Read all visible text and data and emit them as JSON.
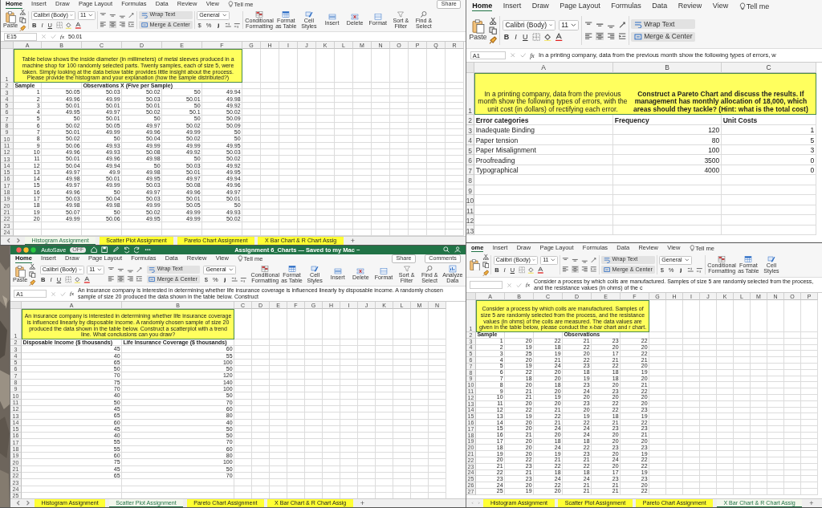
{
  "windows": [
    {
      "tabs": [
        {
          "label": "Home",
          "selected": true
        },
        {
          "label": "Insert",
          "selected": false
        },
        {
          "label": "Draw",
          "selected": false
        },
        {
          "label": "Page Layout",
          "selected": false
        },
        {
          "label": "Formulas",
          "selected": false
        },
        {
          "label": "Data",
          "selected": false
        },
        {
          "label": "Review",
          "selected": false
        },
        {
          "label": "View",
          "selected": false
        }
      ],
      "tell_me": "Tell me",
      "tab_buttons": [
        "Share"
      ],
      "toolbar": {
        "paste": "Paste",
        "font": "Calibri (Body)",
        "size": "11",
        "styles": [
          "B",
          "I",
          "U"
        ],
        "wrap": "Wrap Text",
        "merge": "Merge & Center",
        "number_format": "General",
        "currency": "$",
        "percent": "%",
        "commands": [
          "Conditional Formatting",
          "Format as Table",
          "Cell Styles",
          "Insert",
          "Delete",
          "Format",
          "Sort & Filter",
          "Find & Select"
        ]
      },
      "name_box": "E15",
      "function_label": "fx",
      "formula": "50.01",
      "columns": [
        "A",
        "B",
        "C",
        "D",
        "E",
        "F",
        "G",
        "H",
        "I",
        "J",
        "K",
        "L",
        "M",
        "N",
        "O",
        "P",
        "Q",
        "R"
      ],
      "rows": [
        {
          "number": "1",
          "kind": "note",
          "text": "Table below shows the inside diameter (in millimeters) of metal sleeves produced in a machine shop for 100 randomly selected parts. Twenty samples, each of size 5, were taken. Simply looking at the data below table provides little insight about the process. Please provide the histogram and your explanation (how the sample distributed?)"
        },
        {
          "number": "2",
          "kind": "header",
          "cells": [
            "Sample",
            "Observations X (Five per Sample)"
          ]
        },
        {
          "number": "3",
          "kind": "data",
          "cells": [
            "1",
            "50.05",
            "50.03",
            "50.02",
            "50",
            "49.94"
          ]
        },
        {
          "number": "4",
          "kind": "data",
          "cells": [
            "2",
            "49.96",
            "49.99",
            "50.03",
            "50.01",
            "49.98"
          ]
        },
        {
          "number": "5",
          "kind": "data",
          "cells": [
            "3",
            "50.01",
            "50.01",
            "50.01",
            "50",
            "49.92"
          ]
        },
        {
          "number": "6",
          "kind": "data",
          "cells": [
            "4",
            "49.95",
            "49.97",
            "50.02",
            "50.1",
            "50.02"
          ]
        },
        {
          "number": "7",
          "kind": "data",
          "cells": [
            "5",
            "50",
            "50.01",
            "50",
            "50",
            "50.09"
          ]
        },
        {
          "number": "8",
          "kind": "data",
          "cells": [
            "6",
            "50.02",
            "50.05",
            "49.97",
            "50.02",
            "50.09"
          ]
        },
        {
          "number": "9",
          "kind": "data",
          "cells": [
            "7",
            "50.01",
            "49.99",
            "49.96",
            "49.99",
            "50"
          ]
        },
        {
          "number": "10",
          "kind": "data",
          "cells": [
            "8",
            "50.02",
            "50",
            "50.04",
            "50.02",
            "50"
          ]
        },
        {
          "number": "11",
          "kind": "data",
          "cells": [
            "9",
            "50.06",
            "49.93",
            "49.99",
            "49.99",
            "49.95"
          ]
        },
        {
          "number": "12",
          "kind": "data",
          "cells": [
            "10",
            "49.96",
            "49.93",
            "50.08",
            "49.92",
            "50.03"
          ]
        },
        {
          "number": "13",
          "kind": "data",
          "cells": [
            "11",
            "50.01",
            "49.96",
            "49.98",
            "50",
            "50.02"
          ]
        },
        {
          "number": "14",
          "kind": "data",
          "cells": [
            "12",
            "50.04",
            "49.94",
            "50",
            "50.03",
            "49.92"
          ]
        },
        {
          "number": "15",
          "kind": "data",
          "cells": [
            "13",
            "49.97",
            "49.9",
            "49.98",
            "50.01",
            "49.95"
          ]
        },
        {
          "number": "16",
          "kind": "data",
          "cells": [
            "14",
            "49.98",
            "50.01",
            "49.95",
            "49.97",
            "49.94"
          ]
        },
        {
          "number": "17",
          "kind": "data",
          "cells": [
            "15",
            "49.97",
            "49.99",
            "50.03",
            "50.08",
            "49.96"
          ]
        },
        {
          "number": "18",
          "kind": "data",
          "cells": [
            "16",
            "49.96",
            "50",
            "49.97",
            "49.96",
            "49.97"
          ]
        },
        {
          "number": "19",
          "kind": "data",
          "cells": [
            "17",
            "50.03",
            "50.04",
            "50.03",
            "50.01",
            "50.01"
          ]
        },
        {
          "number": "20",
          "kind": "data",
          "cells": [
            "18",
            "49.98",
            "49.98",
            "49.99",
            "50.05",
            "50"
          ]
        },
        {
          "number": "21",
          "kind": "data",
          "cells": [
            "19",
            "50.07",
            "50",
            "50.02",
            "49.99",
            "49.93"
          ]
        },
        {
          "number": "22",
          "kind": "data",
          "cells": [
            "20",
            "49.99",
            "50.06",
            "49.95",
            "49.99",
            "50.02"
          ]
        },
        {
          "number": "23",
          "kind": "empty"
        },
        {
          "number": "24",
          "kind": "empty"
        }
      ],
      "sheet_tabs": [
        {
          "label": "Histogram Assignment",
          "selected": true
        },
        {
          "label": "Scatter Plot Assignment",
          "selected": false
        },
        {
          "label": "Pareto Chart Assignment",
          "selected": false
        },
        {
          "label": "X Bar Chart & R Chart Assig",
          "selected": false
        }
      ],
      "add_sheet": "+"
    },
    {
      "tabs": [
        {
          "label": "Home",
          "selected": true
        },
        {
          "label": "Insert",
          "selected": false
        },
        {
          "label": "Draw",
          "selected": false
        },
        {
          "label": "Page Layout",
          "selected": false
        },
        {
          "label": "Formulas",
          "selected": false
        },
        {
          "label": "Data",
          "selected": false
        },
        {
          "label": "Review",
          "selected": false
        },
        {
          "label": "View",
          "selected": false
        }
      ],
      "tell_me": "Tell me",
      "toolbar": {
        "paste": "Paste",
        "font": "Calibri (Body)",
        "size": "11",
        "styles": [
          "B",
          "I",
          "U"
        ],
        "wrap": "Wrap Text",
        "merge": "Merge & Center"
      },
      "name_box": "A1",
      "function_label": "fx",
      "formula": "In a printing company, data from the previous month show the following types of errors, w",
      "columns": [
        "A",
        "B",
        "C"
      ],
      "rows": [
        {
          "number": "1",
          "kind": "note",
          "text": "In a printing company, data from the previous month show the following types of errors, with the unit cost (in dollars) of rectifying each error. **Construct a Pareto Chart and discuss the results. If management has monthly allocation of 18,000, which areas should they tackle? (Hint: what is the total cost)**"
        },
        {
          "number": "2",
          "kind": "header",
          "cells": [
            "Error categories",
            "Frequency",
            "Unit Costs"
          ]
        },
        {
          "number": "3",
          "kind": "data",
          "cells": [
            "Inadequate Binding",
            "120",
            "1"
          ]
        },
        {
          "number": "4",
          "kind": "data",
          "cells": [
            "Paper tension",
            "80",
            "5"
          ]
        },
        {
          "number": "5",
          "kind": "data",
          "cells": [
            "Paper Misalignment",
            "100",
            "3"
          ]
        },
        {
          "number": "6",
          "kind": "data",
          "cells": [
            "Proofreading",
            "3500",
            "0"
          ]
        },
        {
          "number": "7",
          "kind": "data",
          "cells": [
            "Typographical",
            "4000",
            "0"
          ]
        },
        {
          "number": "8",
          "kind": "empty"
        },
        {
          "number": "9",
          "kind": "empty"
        },
        {
          "number": "10",
          "kind": "empty"
        },
        {
          "number": "11",
          "kind": "empty"
        },
        {
          "number": "12",
          "kind": "empty"
        },
        {
          "number": "13",
          "kind": "empty"
        }
      ]
    },
    {
      "title_bar": {
        "autosave": "AutoSave",
        "autosave_state": "OFF",
        "title": "Assignment 6_Charts — Saved to my Mac ~"
      },
      "tabs": [
        {
          "label": "Home",
          "selected": true
        },
        {
          "label": "Insert",
          "selected": false
        },
        {
          "label": "Draw",
          "selected": false
        },
        {
          "label": "Page Layout",
          "selected": false
        },
        {
          "label": "Formulas",
          "selected": false
        },
        {
          "label": "Data",
          "selected": false
        },
        {
          "label": "Review",
          "selected": false
        },
        {
          "label": "View",
          "selected": false
        }
      ],
      "tell_me": "Tell me",
      "tab_buttons": [
        "Share",
        "Comments"
      ],
      "toolbar": {
        "paste": "Paste",
        "font": "Calibri (Body)",
        "size": "11",
        "styles": [
          "B",
          "I",
          "U"
        ],
        "wrap": "Wrap Text",
        "merge": "Merge & Center",
        "number_format": "General",
        "currency": "$",
        "percent": "%",
        "commands": [
          "Conditional Formatting",
          "Format as Table",
          "Cell Styles",
          "Insert",
          "Delete",
          "Format",
          "Sort & Filter",
          "Find & Select",
          "Analyze Data"
        ]
      },
      "name_box": "A1",
      "function_label": "fx",
      "formula": "An insurance company is interested in determining whether life insurance coverage is influenced linearly by disposable income. A randomly chosen sample of size 20 produced the data shown in the table below. Construct",
      "columns": [
        "A",
        "B",
        "C",
        "D",
        "E",
        "F",
        "G",
        "H",
        "I",
        "J",
        "K",
        "L",
        "M",
        "N"
      ],
      "rows": [
        {
          "number": "1",
          "kind": "note",
          "text": "An insurance company is interested in determining whether life insurance coverage is influenced linearly by disposable income. A randomly chosen sample of size 20 produced the data shown in the table below. Construct a scatterplot with a trend line. What conclusions can you draw?"
        },
        {
          "number": "2",
          "kind": "header",
          "cells": [
            "Disposable Income ($ thousands)",
            "Life Insurance Coverage ($ thousands)"
          ]
        },
        {
          "number": "3",
          "kind": "data",
          "cells": [
            "45",
            "60"
          ]
        },
        {
          "number": "4",
          "kind": "data",
          "cells": [
            "40",
            "55"
          ]
        },
        {
          "number": "5",
          "kind": "data",
          "cells": [
            "65",
            "100"
          ]
        },
        {
          "number": "6",
          "kind": "data",
          "cells": [
            "50",
            "50"
          ]
        },
        {
          "number": "7",
          "kind": "data",
          "cells": [
            "70",
            "120"
          ]
        },
        {
          "number": "8",
          "kind": "data",
          "cells": [
            "75",
            "140"
          ]
        },
        {
          "number": "9",
          "kind": "data",
          "cells": [
            "70",
            "100"
          ]
        },
        {
          "number": "10",
          "kind": "data",
          "cells": [
            "40",
            "50"
          ]
        },
        {
          "number": "11",
          "kind": "data",
          "cells": [
            "50",
            "70"
          ]
        },
        {
          "number": "12",
          "kind": "data",
          "cells": [
            "45",
            "60"
          ]
        },
        {
          "number": "13",
          "kind": "data",
          "cells": [
            "65",
            "80"
          ]
        },
        {
          "number": "14",
          "kind": "data",
          "cells": [
            "60",
            "40"
          ]
        },
        {
          "number": "15",
          "kind": "data",
          "cells": [
            "45",
            "50"
          ]
        },
        {
          "number": "16",
          "kind": "data",
          "cells": [
            "40",
            "50"
          ]
        },
        {
          "number": "17",
          "kind": "data",
          "cells": [
            "55",
            "70"
          ]
        },
        {
          "number": "18",
          "kind": "data",
          "cells": [
            "55",
            "60"
          ]
        },
        {
          "number": "19",
          "kind": "data",
          "cells": [
            "60",
            "80"
          ]
        },
        {
          "number": "20",
          "kind": "data",
          "cells": [
            "75",
            "100"
          ]
        },
        {
          "number": "21",
          "kind": "data",
          "cells": [
            "45",
            "50"
          ]
        },
        {
          "number": "22",
          "kind": "data",
          "cells": [
            "65",
            "70"
          ]
        },
        {
          "number": "23",
          "kind": "empty"
        },
        {
          "number": "24",
          "kind": "empty"
        },
        {
          "number": "25",
          "kind": "empty"
        }
      ],
      "sheet_tabs": [
        {
          "label": "Histogram Assignment",
          "selected": false
        },
        {
          "label": "Scatter Plot Assignment",
          "selected": true
        },
        {
          "label": "Pareto Chart Assignment",
          "selected": false
        },
        {
          "label": "X Bar Chart & R Chart Assig",
          "selected": false
        }
      ],
      "add_sheet": "+"
    },
    {
      "tabs": [
        {
          "label": "ome",
          "selected": true
        },
        {
          "label": "Insert",
          "selected": false
        },
        {
          "label": "Draw",
          "selected": false
        },
        {
          "label": "Page Layout",
          "selected": false
        },
        {
          "label": "Formulas",
          "selected": false
        },
        {
          "label": "Data",
          "selected": false
        },
        {
          "label": "Review",
          "selected": false
        },
        {
          "label": "View",
          "selected": false
        }
      ],
      "tell_me": "Tell me",
      "toolbar": {
        "font": "Calibri (Body)",
        "size": "11",
        "styles": [
          "B",
          "I",
          "U"
        ],
        "wrap": "Wrap Text",
        "merge": "Merge & Center",
        "number_format": "General",
        "currency": "$",
        "percent": "%",
        "commands": [
          "Conditional Formatting",
          "Format as Table",
          "Cell Styles"
        ]
      },
      "function_label": "fx",
      "formula": "Consider a process by which coils are manufactured. Samples of size 5 are randomly selected from the process, and the resistance values (in ohms) of the c",
      "columns": [
        "A",
        "B",
        "C",
        "D",
        "E",
        "F",
        "G",
        "H",
        "I",
        "J",
        "K",
        "L",
        "M",
        "N",
        "O",
        "P"
      ],
      "rows": [
        {
          "number": "1",
          "kind": "note",
          "text": "Consider a process by which coils are manufactured. Samples of size 5 are randomly selected from the process, and the resistance values (in ohms) of the coils are measured. The data values are given in the table below, please conduct the x-bar chart and r chart."
        },
        {
          "number": "2",
          "kind": "header",
          "cells": [
            "Sample",
            "Observations"
          ]
        },
        {
          "number": "3",
          "kind": "data",
          "cells": [
            "1",
            "20",
            "22",
            "21",
            "23",
            "22"
          ]
        },
        {
          "number": "4",
          "kind": "data",
          "cells": [
            "2",
            "19",
            "18",
            "22",
            "20",
            "20"
          ]
        },
        {
          "number": "5",
          "kind": "data",
          "cells": [
            "3",
            "25",
            "19",
            "20",
            "17",
            "22"
          ]
        },
        {
          "number": "6",
          "kind": "data",
          "cells": [
            "4",
            "20",
            "21",
            "22",
            "21",
            "21"
          ]
        },
        {
          "number": "7",
          "kind": "data",
          "cells": [
            "5",
            "19",
            "24",
            "23",
            "22",
            "20"
          ]
        },
        {
          "number": "8",
          "kind": "data",
          "cells": [
            "6",
            "22",
            "20",
            "18",
            "18",
            "19"
          ]
        },
        {
          "number": "9",
          "kind": "data",
          "cells": [
            "7",
            "18",
            "20",
            "19",
            "18",
            "20"
          ]
        },
        {
          "number": "10",
          "kind": "data",
          "cells": [
            "8",
            "20",
            "18",
            "23",
            "20",
            "21"
          ]
        },
        {
          "number": "11",
          "kind": "data",
          "cells": [
            "9",
            "21",
            "20",
            "24",
            "23",
            "22"
          ]
        },
        {
          "number": "12",
          "kind": "data",
          "cells": [
            "10",
            "21",
            "19",
            "20",
            "20",
            "20"
          ]
        },
        {
          "number": "13",
          "kind": "data",
          "cells": [
            "11",
            "20",
            "20",
            "23",
            "22",
            "20"
          ]
        },
        {
          "number": "14",
          "kind": "data",
          "cells": [
            "12",
            "22",
            "21",
            "20",
            "22",
            "23"
          ]
        },
        {
          "number": "15",
          "kind": "data",
          "cells": [
            "13",
            "19",
            "22",
            "19",
            "18",
            "19"
          ]
        },
        {
          "number": "16",
          "kind": "data",
          "cells": [
            "14",
            "20",
            "21",
            "22",
            "21",
            "22"
          ]
        },
        {
          "number": "17",
          "kind": "data",
          "cells": [
            "15",
            "20",
            "24",
            "24",
            "23",
            "23"
          ]
        },
        {
          "number": "18",
          "kind": "data",
          "cells": [
            "16",
            "21",
            "20",
            "24",
            "20",
            "21"
          ]
        },
        {
          "number": "19",
          "kind": "data",
          "cells": [
            "17",
            "20",
            "18",
            "18",
            "20",
            "20"
          ]
        },
        {
          "number": "20",
          "kind": "data",
          "cells": [
            "18",
            "20",
            "24",
            "22",
            "23",
            "23"
          ]
        },
        {
          "number": "21",
          "kind": "data",
          "cells": [
            "19",
            "20",
            "19",
            "23",
            "20",
            "19"
          ]
        },
        {
          "number": "22",
          "kind": "data",
          "cells": [
            "20",
            "22",
            "21",
            "21",
            "24",
            "22"
          ]
        },
        {
          "number": "23",
          "kind": "data",
          "cells": [
            "21",
            "23",
            "22",
            "22",
            "20",
            "22"
          ]
        },
        {
          "number": "24",
          "kind": "data",
          "cells": [
            "22",
            "21",
            "18",
            "18",
            "17",
            "19"
          ]
        },
        {
          "number": "25",
          "kind": "data",
          "cells": [
            "23",
            "23",
            "24",
            "24",
            "23",
            "23"
          ]
        },
        {
          "number": "26",
          "kind": "data",
          "cells": [
            "24",
            "20",
            "22",
            "21",
            "21",
            "20"
          ]
        },
        {
          "number": "27",
          "kind": "data",
          "cells": [
            "25",
            "19",
            "20",
            "21",
            "21",
            "22"
          ]
        }
      ],
      "sheet_tabs": [
        {
          "label": "Histogram Assignment",
          "selected": false
        },
        {
          "label": "Scatter Plot Assignment",
          "selected": false
        },
        {
          "label": "Pareto Chart Assignment",
          "selected": false
        },
        {
          "label": "X Bar Chart & R Chart Assig",
          "selected": true
        }
      ],
      "add_sheet": "+"
    }
  ]
}
